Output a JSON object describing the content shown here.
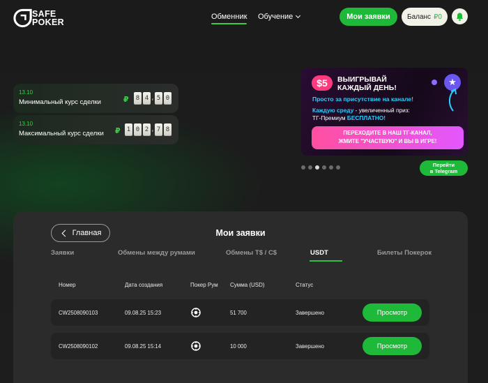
{
  "header": {
    "logo_line1": "SAFE",
    "logo_line2": "POKER",
    "nav": {
      "exchange": "Обменник",
      "learning": "Обучение"
    },
    "my_orders": "Мои заявки",
    "balance_label": "Баланс",
    "balance_amount": "₽0"
  },
  "rates": [
    {
      "date": "13.10",
      "label": "Минимальный курс сделки",
      "currency": "₽",
      "digits": [
        "8",
        "4",
        ",",
        "5",
        "0"
      ]
    },
    {
      "date": "13.10",
      "label": "Максимальный курс сделки",
      "currency": "₽",
      "digits": [
        "1",
        "0",
        "2",
        ",",
        "7",
        "8"
      ]
    }
  ],
  "banner": {
    "bubble": "$5",
    "title_line1": "ВЫИГРЫВАЙ",
    "title_line2": "КАЖДЫЙ ДЕНЬ!",
    "subtitle": "Просто за присутствие на канале!",
    "text_hl": "Каждую среду",
    "text_rest": " - увеличенный приз:",
    "text_line2": "ТГ-Премиум ",
    "text_line2_hl": "БЕСПЛАТНО!",
    "cta_line1": "ПЕРЕХОДИТЕ В НАШ ТГ-КАНАЛ,",
    "cta_line2": "ЖМИТЕ \"УЧАСТВУЮ\" И ВЫ В ИГРЕ!",
    "carousel_active_index": 2,
    "carousel_count": 6
  },
  "telegram_button": {
    "line1": "Перейти",
    "line2": "в Telegram"
  },
  "orders": {
    "back": "Главная",
    "title": "Мои заявки",
    "tabs": [
      "Заявки",
      "Обмены между румами",
      "Обмены T$ / C$",
      "USDT",
      "Билеты Покерок"
    ],
    "active_tab": "USDT",
    "columns": [
      "Номер",
      "Дата создания",
      "Покер Рум",
      "Сумма (USD)",
      "Статус"
    ],
    "rows": [
      {
        "number": "CW2508090103",
        "date": "09.08.25 15:23",
        "room_icon": "poker-room-icon",
        "amount": "51 700",
        "status": "Завершено",
        "action": "Просмотр"
      },
      {
        "number": "CW2508090102",
        "date": "09.08.25 15:14",
        "room_icon": "poker-room-icon",
        "amount": "10 000",
        "status": "Завершено",
        "action": "Просмотр"
      }
    ]
  },
  "colors": {
    "accent": "#1fb93a",
    "background": "#1b1b1b",
    "panel": "#2a2b2a",
    "banner_pink": "#ff4fa0",
    "banner_cyan": "#27d0ff"
  }
}
